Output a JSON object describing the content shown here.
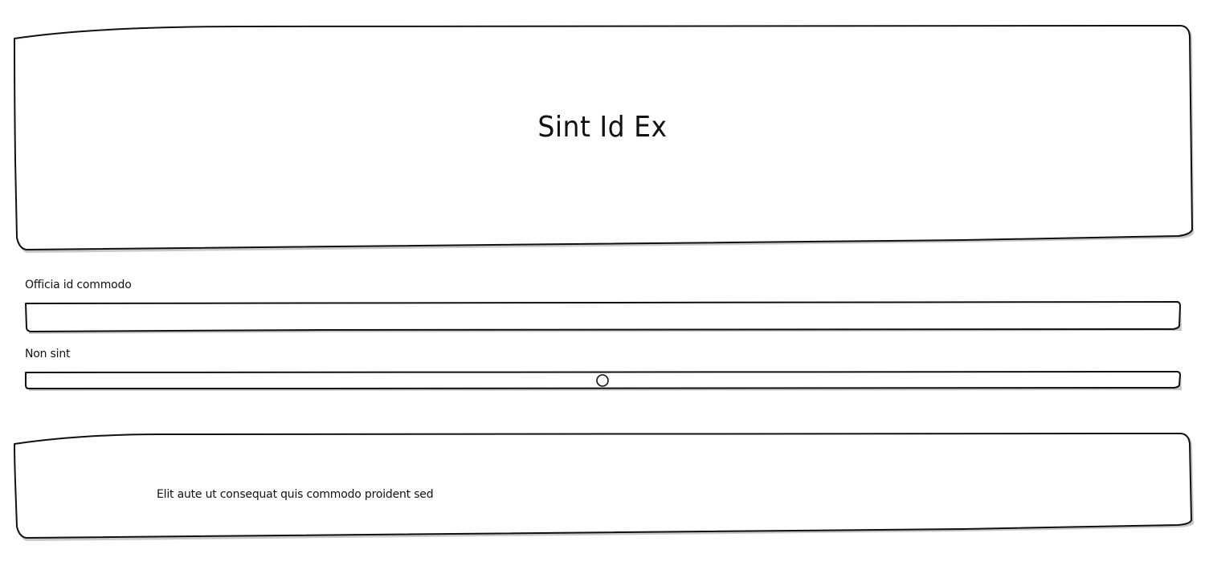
{
  "header": {
    "title": "Sint Id Ex"
  },
  "form": {
    "text_field": {
      "label": "Officia id commodo",
      "value": "",
      "placeholder": ""
    },
    "range_field": {
      "label": "Non sint",
      "value": 50,
      "min": 0,
      "max": 100
    }
  },
  "footer": {
    "text": "Elit aute ut consequat quis commodo proident sed"
  }
}
